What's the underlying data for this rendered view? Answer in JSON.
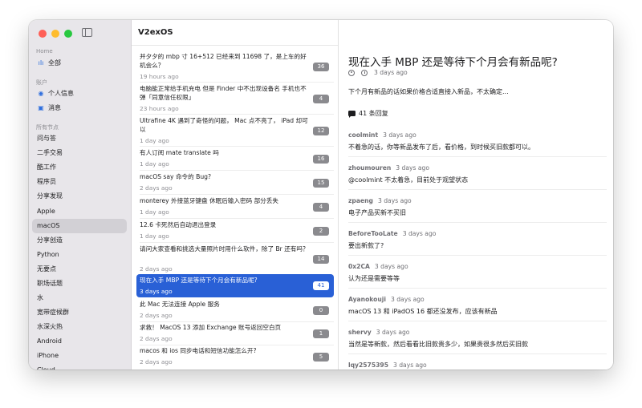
{
  "colors": {
    "accent": "#2960d6",
    "close": "#fe5f57",
    "minimize": "#febc2e",
    "zoom": "#28c840"
  },
  "sidebar": {
    "sections": [
      {
        "label": "Home",
        "items": [
          {
            "label": "全部",
            "icon": "waveform-icon"
          }
        ]
      },
      {
        "label": "账户",
        "items": [
          {
            "label": "个人信息",
            "icon": "person-circle-icon"
          },
          {
            "label": "消息",
            "icon": "message-icon"
          }
        ]
      },
      {
        "label": "所有节点",
        "items": [
          {
            "label": "问与答"
          },
          {
            "label": "二手交易"
          },
          {
            "label": "酷工作"
          },
          {
            "label": "程序员"
          },
          {
            "label": "分享发现"
          },
          {
            "label": "Apple"
          },
          {
            "label": "macOS",
            "selected": true
          },
          {
            "label": "分享创造"
          },
          {
            "label": "Python"
          },
          {
            "label": "无要点"
          },
          {
            "label": "职场话题"
          },
          {
            "label": "水"
          },
          {
            "label": "宽带症候群"
          },
          {
            "label": "水深火热"
          },
          {
            "label": "Android"
          },
          {
            "label": "iPhone"
          },
          {
            "label": "Cloud"
          }
        ]
      }
    ]
  },
  "list": {
    "app_title": "V2exOS",
    "topics": [
      {
        "title": "并夕夕的 mbp 寸 16+512 已经来到 11698 了，是上车的好机会么？",
        "time": "19 hours ago",
        "replies": "36"
      },
      {
        "title": "电脑能正常给手机充电 但是 Finder 中不出现设备名 手机也不弹「同意信任权限」",
        "time": "23 hours ago",
        "replies": "4"
      },
      {
        "title": "Ultrafine 4K 遇到了奇怪的问题， Mac 点不亮了， iPad 却可以",
        "time": "1 day ago",
        "replies": "12"
      },
      {
        "title": "有人订阅 mate translate 吗",
        "time": "1 day ago",
        "replies": "16"
      },
      {
        "title": "macOS say 命令的 Bug?",
        "time": "2 days ago",
        "replies": "15"
      },
      {
        "title": "monterey 外接蓝牙键盘 休眠后输入密码 部分丢失",
        "time": "1 day ago",
        "replies": "4"
      },
      {
        "title": "12.6 卡死然后自动退出登录",
        "time": "1 day ago",
        "replies": "2"
      },
      {
        "title": "请问大家查看和挑选大量照片时用什么软件，除了 Br 还有吗？",
        "time": "2 days ago",
        "replies": "14"
      },
      {
        "title": "现在入手 MBP 还是等待下个月会有新品呢?",
        "time": "3 days ago",
        "replies": "41",
        "selected": true
      },
      {
        "title": "此 Mac 无法连接 Apple 服务",
        "time": "2 days ago",
        "replies": "0"
      },
      {
        "title": "求救！ MacOS 13 添加 Exchange 账号返回空白页",
        "time": "2 days ago",
        "replies": "1"
      },
      {
        "title": "macos 和 ios 同步电话和短信功能怎么开?",
        "time": "2 days ago",
        "replies": "5"
      }
    ]
  },
  "detail": {
    "title": "现在入手 MBP 还是等待下个月会有新品呢?",
    "time": "3 days ago",
    "body": "下个月有新品的话如果价格合适直接入新品，不太确定...",
    "reply_count": "41 条回复",
    "comments": [
      {
        "author": "coolmint",
        "time": "3 days ago",
        "text": "不着急的话，你等新品发布了后，看价格，到时候买旧款都可以。"
      },
      {
        "author": "zhoumouren",
        "time": "3 days ago",
        "text": "@coolmint 不太着急，目前处于观望状态"
      },
      {
        "author": "zpaeng",
        "time": "3 days ago",
        "text": "电子产品买新不买旧"
      },
      {
        "author": "BeforeTooLate",
        "time": "3 days ago",
        "text": "要出新款了?"
      },
      {
        "author": "0x2CA",
        "time": "3 days ago",
        "text": "认为还是需要等等"
      },
      {
        "author": "Ayanokouji",
        "time": "3 days ago",
        "text": "macOS 13 和 iPadOS 16 都还没发布，应该有新品"
      },
      {
        "author": "shervy",
        "time": "3 days ago",
        "text": "当然是等新款，然后看看比旧款贵多少，如果贵很多然后买旧款"
      },
      {
        "author": "lqy2575395",
        "time": "3 days ago",
        "text": ""
      }
    ]
  }
}
